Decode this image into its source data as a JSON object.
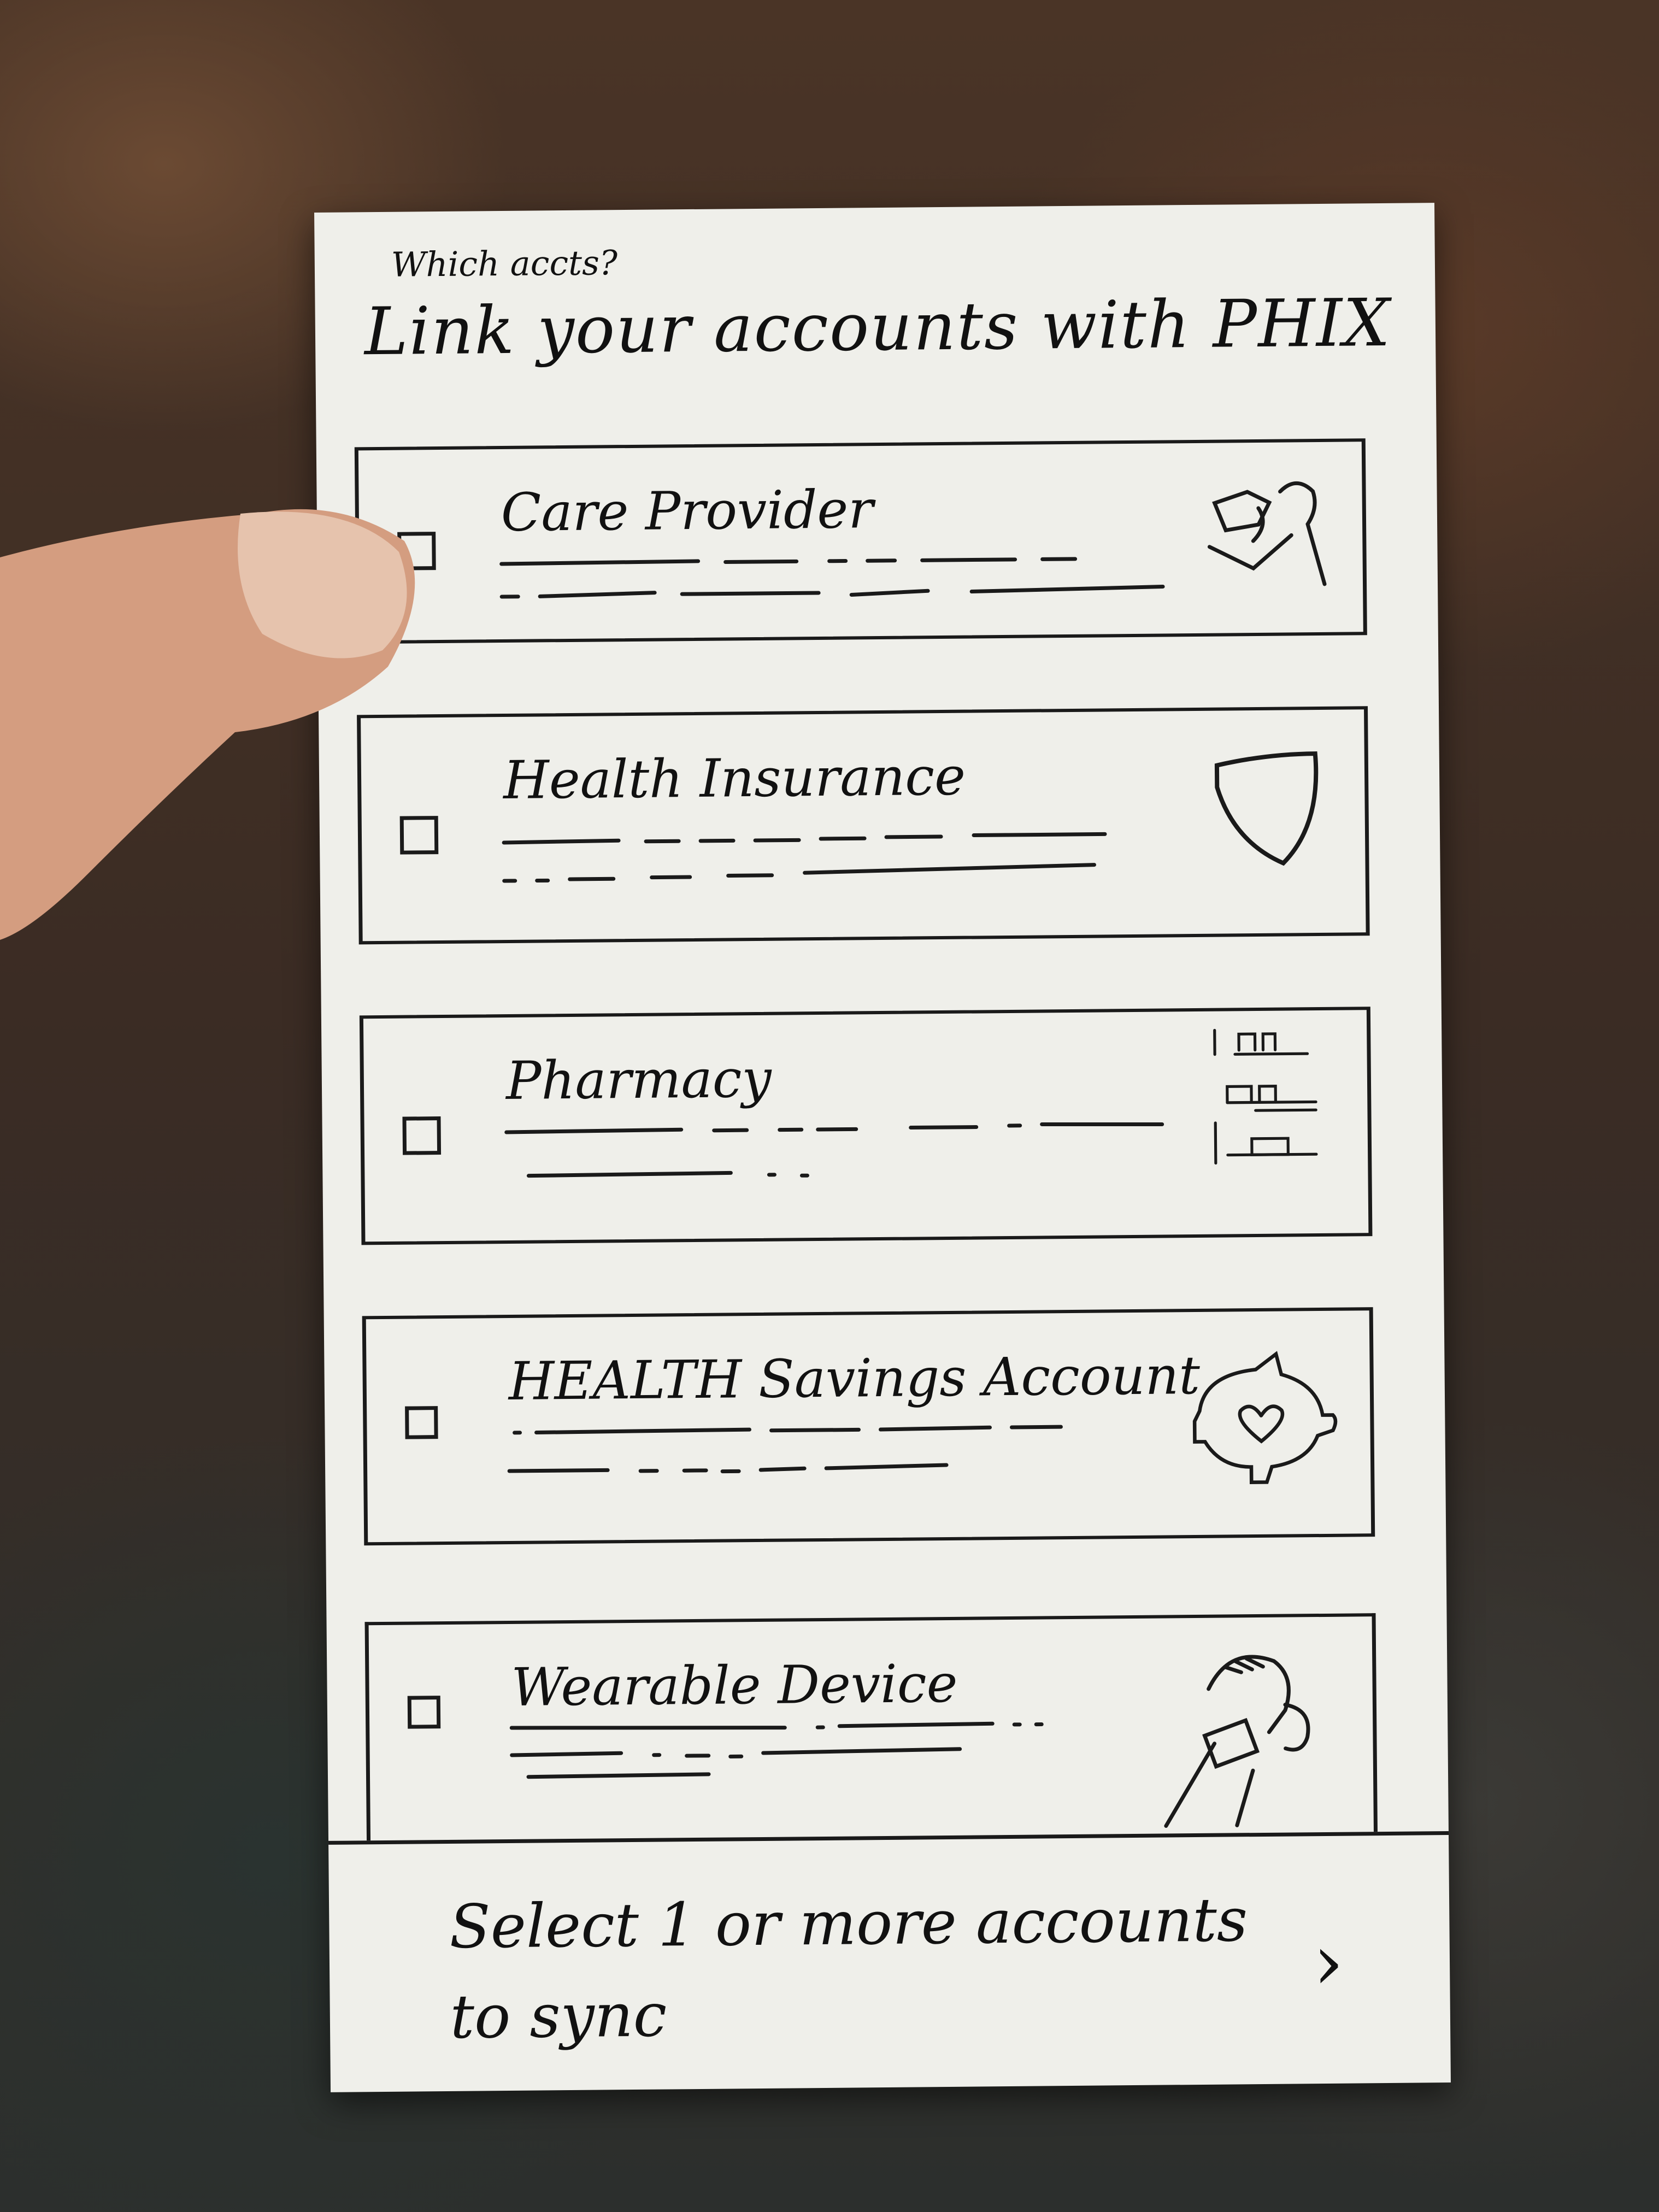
{
  "screen": {
    "note": "Which accts?",
    "title": "Link your accounts with PHIX"
  },
  "accounts": [
    {
      "label": "Care Provider",
      "icon": "doctor-icon",
      "checked": false
    },
    {
      "label": "Health Insurance",
      "icon": "shield-icon",
      "checked": false
    },
    {
      "label": "Pharmacy",
      "icon": "pharmacy-shelf-icon",
      "checked": false
    },
    {
      "label": "HEALTH Savings Account",
      "icon": "piggy-bank-heart-icon",
      "checked": false
    },
    {
      "label": "Wearable Device",
      "icon": "smartwatch-wrist-icon",
      "checked": false
    }
  ],
  "footer": {
    "text": "Select 1 or more accounts to sync",
    "next_icon": "chevron-right-icon"
  }
}
